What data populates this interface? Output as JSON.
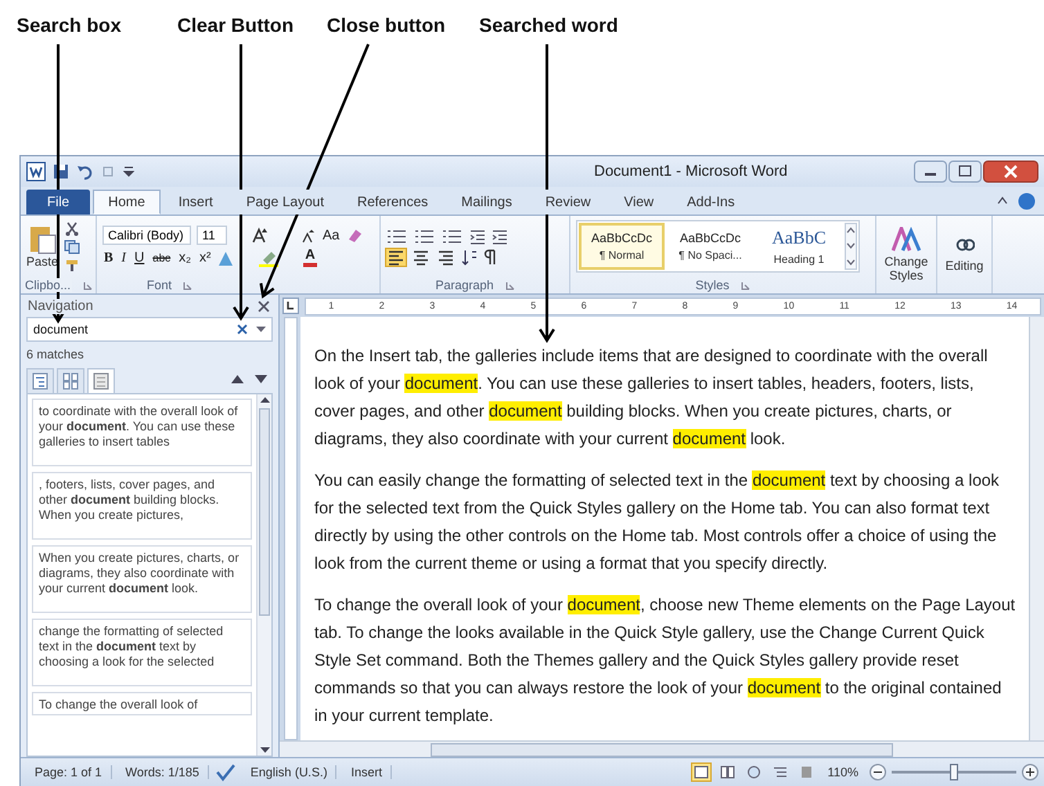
{
  "annotations": [
    {
      "label": "Search box"
    },
    {
      "label": "Clear Button"
    },
    {
      "label": "Close button"
    },
    {
      "label": "Searched word"
    }
  ],
  "window": {
    "title": "Document1 - Microsoft Word"
  },
  "tabs": [
    {
      "label": "File",
      "kind": "file",
      "selected": false
    },
    {
      "label": "Home",
      "kind": "tab",
      "selected": true
    },
    {
      "label": "Insert",
      "kind": "tab",
      "selected": false
    },
    {
      "label": "Page Layout",
      "kind": "tab",
      "selected": false
    },
    {
      "label": "References",
      "kind": "tab",
      "selected": false
    },
    {
      "label": "Mailings",
      "kind": "tab",
      "selected": false
    },
    {
      "label": "Review",
      "kind": "tab",
      "selected": false
    },
    {
      "label": "View",
      "kind": "tab",
      "selected": false
    },
    {
      "label": "Add-Ins",
      "kind": "tab",
      "selected": false
    }
  ],
  "ribbon": {
    "clipboard": {
      "paste": "Paste",
      "group": "Clipbo..."
    },
    "font": {
      "name": "Calibri (Body)",
      "size": "11",
      "case": "Aa",
      "format_buttons": [
        "B",
        "I",
        "U",
        "abc",
        "x₂",
        "x²"
      ],
      "color_button": "A",
      "group": "Font"
    },
    "paragraph": {
      "group": "Paragraph"
    },
    "styles": {
      "items": [
        {
          "sample": "AaBbCcDc",
          "name": "¶ Normal",
          "kind": "body",
          "selected": true
        },
        {
          "sample": "AaBbCcDc",
          "name": "¶ No Spaci...",
          "kind": "body",
          "selected": false
        },
        {
          "sample": "AaBbC",
          "name": "Heading 1",
          "kind": "heading",
          "selected": false
        }
      ],
      "group": "Styles"
    },
    "change_styles": "Change Styles",
    "editing": "Editing"
  },
  "navigation": {
    "title": "Navigation",
    "search": "document",
    "matches": "6 matches",
    "view_tabs": [
      {
        "kind": "headings",
        "selected": false
      },
      {
        "kind": "pages",
        "selected": false
      },
      {
        "kind": "results",
        "selected": true
      }
    ],
    "results": [
      "to coordinate with the overall look of your **document**. You can use these galleries to insert tables",
      ", footers, lists, cover pages, and other **document** building blocks. When you create pictures,",
      "When you create pictures, charts, or diagrams, they also coordinate with your current **document** look.",
      "change the formatting of selected text in the **document** text by choosing a look for the selected",
      "To change the overall look of"
    ]
  },
  "ruler": {
    "marks": [
      "1",
      "2",
      "3",
      "4",
      "5",
      "6",
      "7",
      "8",
      "9",
      "10",
      "11",
      "12",
      "13",
      "14"
    ]
  },
  "document": {
    "paragraphs": [
      [
        {
          "text": "On the Insert tab, the galleries include items that are designed to coordinate with the overall look of your ",
          "highlighted": false
        },
        {
          "text": "document",
          "highlighted": true
        },
        {
          "text": ". You can use these galleries to insert tables, headers, footers, lists, cover pages, and other ",
          "highlighted": false
        },
        {
          "text": "document",
          "highlighted": true
        },
        {
          "text": " building blocks. When you create pictures, charts, or diagrams, they also coordinate with your current ",
          "highlighted": false
        },
        {
          "text": "document",
          "highlighted": true
        },
        {
          "text": " look.",
          "highlighted": false
        }
      ],
      [
        {
          "text": "You can easily change the formatting of selected text in the ",
          "highlighted": false
        },
        {
          "text": "document",
          "highlighted": true
        },
        {
          "text": " text by choosing a look for the selected text from the Quick Styles gallery on the Home tab. You can also format text directly by using the other controls on the Home tab. Most controls offer a choice of using the look from the current theme or using a format that you specify directly.",
          "highlighted": false
        }
      ],
      [
        {
          "text": "To change the overall look of your ",
          "highlighted": false
        },
        {
          "text": "document",
          "highlighted": true
        },
        {
          "text": ", choose new Theme elements on the Page Layout tab. To change the looks available in the Quick Style gallery, use the Change Current Quick Style Set command. Both the Themes gallery and the Quick Styles gallery provide reset commands so that you can always restore the look of your ",
          "highlighted": false
        },
        {
          "text": "document",
          "highlighted": true
        },
        {
          "text": " to the original contained in your current template.",
          "highlighted": false
        }
      ]
    ]
  },
  "status_bar": {
    "page": "Page: 1 of 1",
    "words": "Words: 1/185",
    "language": "English (U.S.)",
    "mode": "Insert",
    "views": [
      {
        "kind": "print",
        "selected": true
      },
      {
        "kind": "reading",
        "selected": false
      },
      {
        "kind": "web",
        "selected": false
      },
      {
        "kind": "outline",
        "selected": false
      },
      {
        "kind": "draft",
        "selected": false
      }
    ],
    "zoom": "110%",
    "zoom_slider": {
      "level": 0.5
    }
  }
}
